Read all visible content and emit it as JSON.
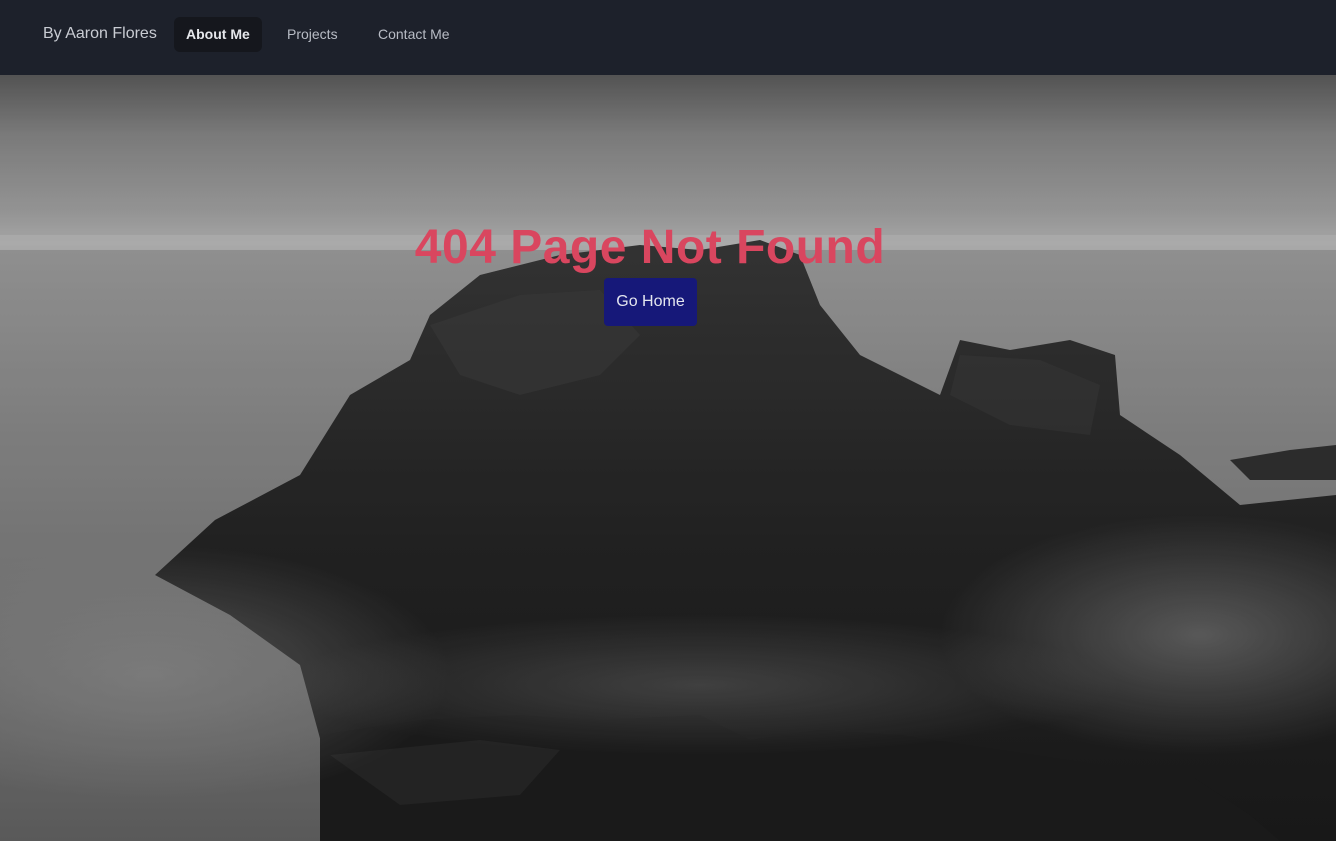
{
  "navbar": {
    "brand": "By Aaron Flores",
    "items": [
      {
        "label": "About Me",
        "active": true
      },
      {
        "label": "Projects",
        "active": false
      },
      {
        "label": "Contact Me",
        "active": false
      }
    ]
  },
  "main": {
    "heading": "404 Page Not Found",
    "button_label": "Go Home"
  },
  "colors": {
    "navbar_bg": "#1d212b",
    "heading": "#d9465f",
    "button_bg": "#161879"
  }
}
